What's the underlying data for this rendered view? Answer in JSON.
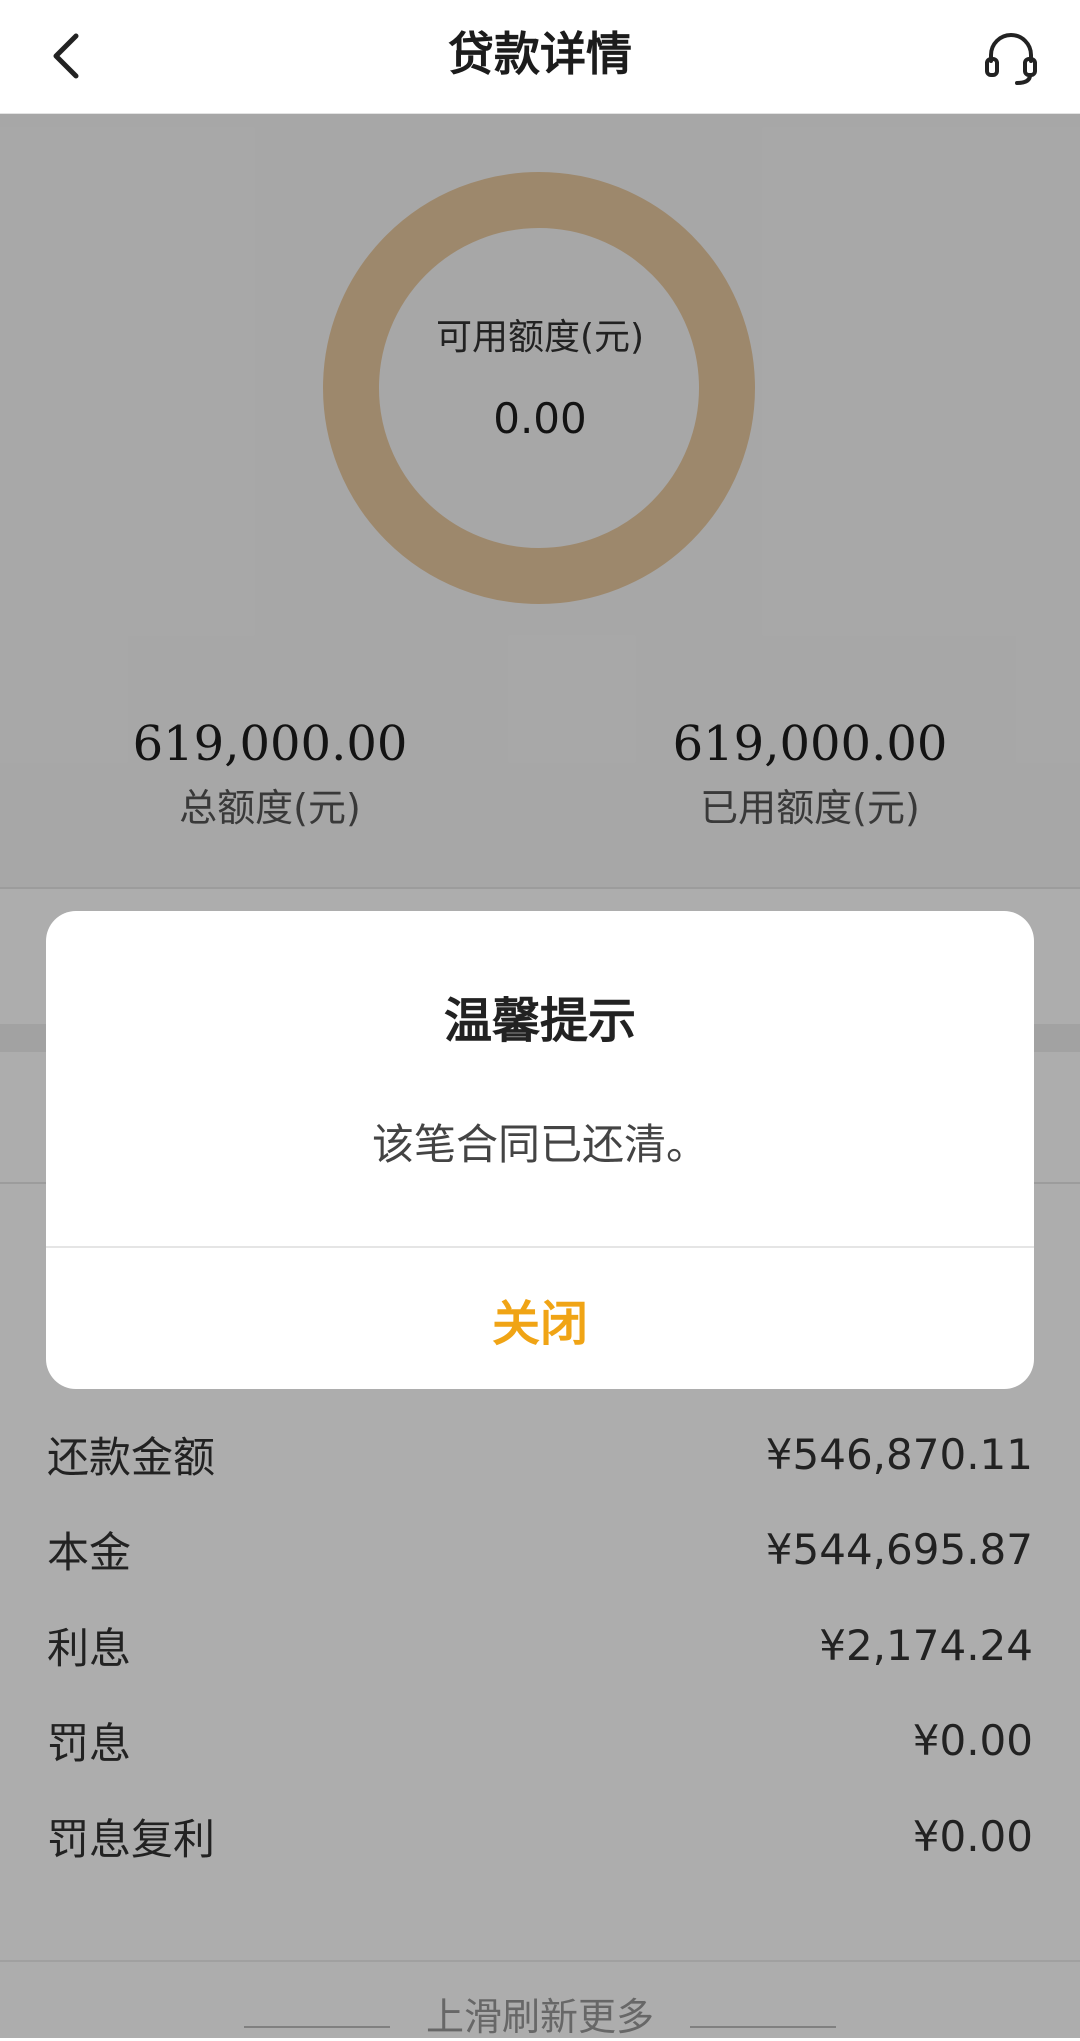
{
  "nav": {
    "title": "贷款详情",
    "back_icon": "chevron-left-icon",
    "service_icon": "headset-icon"
  },
  "hero": {
    "available_label": "可用额度(元)",
    "available_value": "0.00",
    "total_value": "619,000.00",
    "total_label": "总额度(元)",
    "used_value": "619,000.00",
    "used_label": "已用额度(元)",
    "ring_color": "#e8c9a0"
  },
  "details": [
    {
      "label": "还款金额",
      "value": "¥546,870.11"
    },
    {
      "label": "本金",
      "value": "¥544,695.87"
    },
    {
      "label": "利息",
      "value": "¥2,174.24"
    },
    {
      "label": "罚息",
      "value": "¥0.00"
    },
    {
      "label": "罚息复利",
      "value": "¥0.00"
    }
  ],
  "footer": {
    "hint": "上滑刷新更多"
  },
  "dialog": {
    "title": "温馨提示",
    "message": "该笔合同已还清。",
    "close_label": "关闭",
    "accent_color": "#f0a415"
  }
}
